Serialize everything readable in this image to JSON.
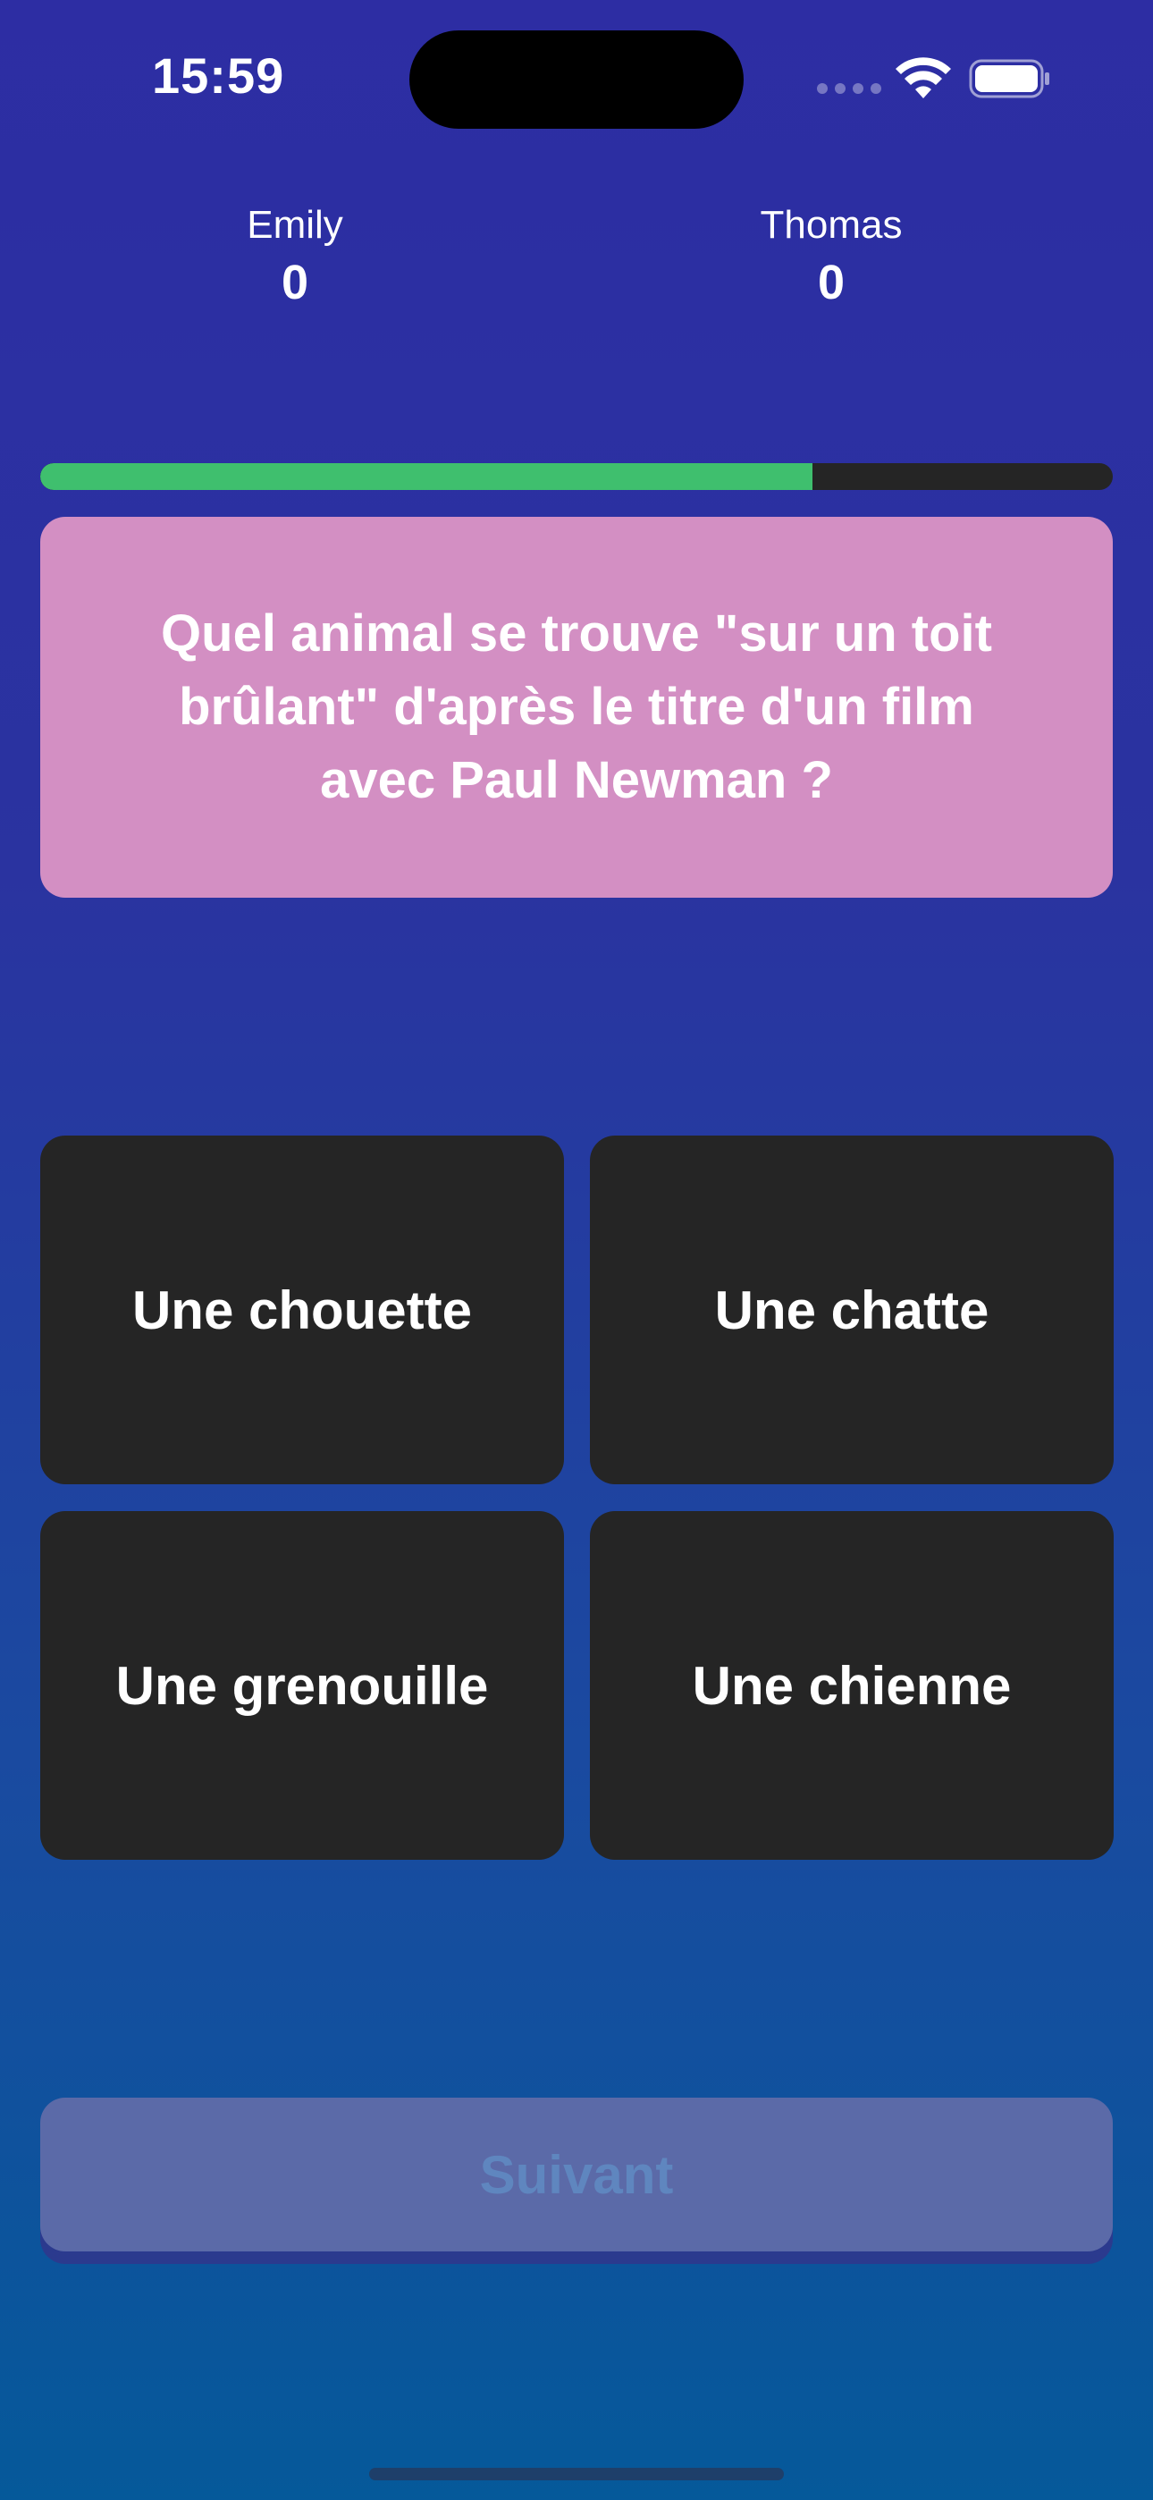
{
  "status_bar": {
    "time": "15:59",
    "icons": [
      "cellular-signal-icon",
      "wifi-icon",
      "battery-icon"
    ]
  },
  "players": [
    {
      "name": "Emily",
      "score": "0"
    },
    {
      "name": "Thomas",
      "score": "0"
    }
  ],
  "progress": {
    "value": 0.72,
    "fill_color": "#3fbf6e",
    "track_color": "#252525"
  },
  "question": {
    "text": "Quel animal se trouve \"sur un toit brûlant\" d'après le titre d'un film avec Paul Newman ?",
    "card_color": "#d38fc3"
  },
  "answers": [
    {
      "label": "Une chouette"
    },
    {
      "label": "Une chatte"
    },
    {
      "label": "Une grenouille"
    },
    {
      "label": "Une chienne"
    }
  ],
  "next_button": {
    "label": "Suivant",
    "enabled": false
  },
  "colors": {
    "background_top": "#2d2da3",
    "background_bottom": "#05599a",
    "answer_background": "#252525"
  }
}
